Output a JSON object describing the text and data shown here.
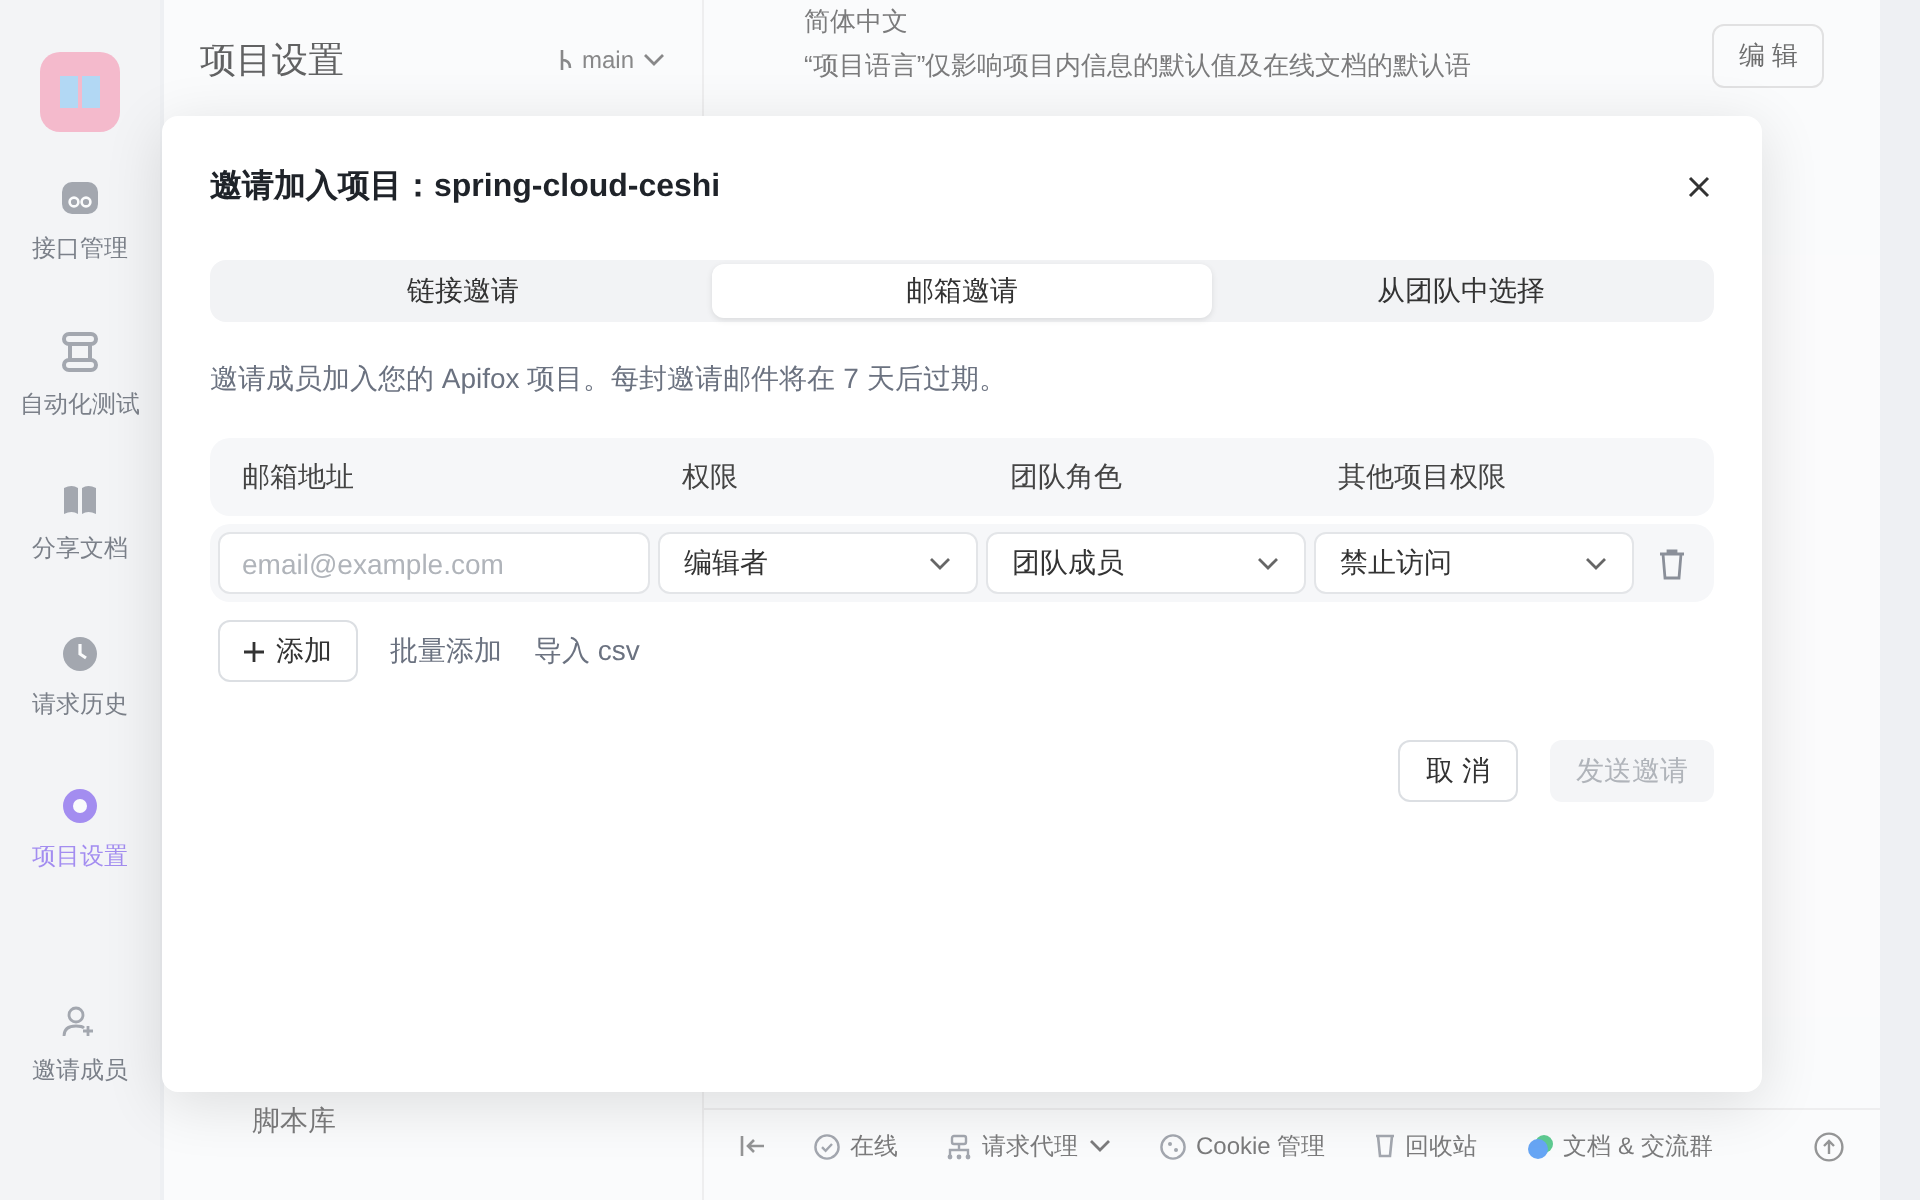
{
  "sidebar": {
    "items": [
      {
        "label": "接口管理",
        "selected": false
      },
      {
        "label": "自动化测试",
        "selected": false
      },
      {
        "label": "分享文档",
        "selected": false
      },
      {
        "label": "请求历史",
        "selected": false
      },
      {
        "label": "项目设置",
        "selected": true
      },
      {
        "label": "邀请成员",
        "selected": false
      }
    ]
  },
  "settings_panel": {
    "title": "项目设置",
    "branch": "main",
    "items": [
      "脚本库"
    ]
  },
  "content": {
    "language_value": "简体中文",
    "language_note": "“项目语言”仅影响项目内信息的默认值及在线文档的默认语",
    "edit_button": "编 辑"
  },
  "status_bar": {
    "items": [
      {
        "label": "在线",
        "dropdown": false
      },
      {
        "label": "请求代理",
        "dropdown": true
      },
      {
        "label": "Cookie 管理",
        "dropdown": false
      },
      {
        "label": "回收站",
        "dropdown": false
      },
      {
        "label": "文档 & 交流群",
        "dropdown": false
      }
    ]
  },
  "dialog": {
    "title": "邀请加入项目：spring-cloud-ceshi",
    "tabs": [
      {
        "label": "链接邀请",
        "selected": false
      },
      {
        "label": "邮箱邀请",
        "selected": true
      },
      {
        "label": "从团队中选择",
        "selected": false
      }
    ],
    "description": "邀请成员加入您的 Apifox 项目。每封邀请邮件将在 7 天后过期。",
    "table": {
      "columns": [
        "邮箱地址",
        "权限",
        "团队角色",
        "其他项目权限"
      ],
      "rows": [
        {
          "email": {
            "placeholder": "email@example.com"
          },
          "permission": "编辑者",
          "team_role": "团队成员",
          "other_permission": "禁止访问"
        }
      ]
    },
    "add_button": "添加",
    "batch_add": "批量添加",
    "import_csv": "导入 csv",
    "cancel_button": "取 消",
    "send_button": {
      "label": "发送邀请",
      "disabled": true
    }
  }
}
